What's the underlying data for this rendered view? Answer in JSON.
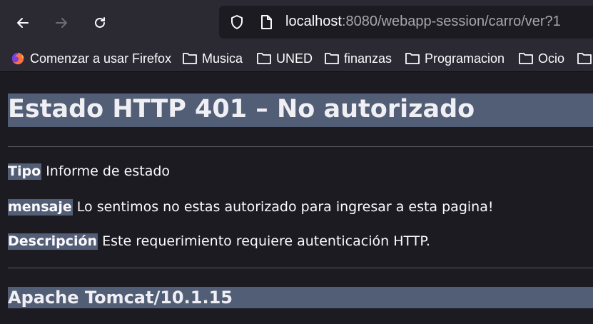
{
  "toolbar": {
    "back_icon": "arrow-left-icon",
    "forward_icon": "arrow-right-icon",
    "reload_icon": "reload-icon",
    "shield_icon": "shield-icon",
    "page_icon": "page-icon"
  },
  "urlbar": {
    "host": "localhost",
    "rest": ":8080/webapp-session/carro/ver?1"
  },
  "bookmarks": [
    {
      "label": "Comenzar a usar Firefox",
      "icon": "firefox-icon"
    },
    {
      "label": "Musica",
      "icon": "folder-icon"
    },
    {
      "label": "UNED",
      "icon": "folder-icon"
    },
    {
      "label": "finanzas",
      "icon": "folder-icon"
    },
    {
      "label": "Programacion",
      "icon": "folder-icon"
    },
    {
      "label": "Ocio",
      "icon": "folder-icon"
    }
  ],
  "page": {
    "title": "Estado HTTP 401 – No autorizado",
    "type_label": "Tipo",
    "type_value": "Informe de estado",
    "message_label": "mensaje",
    "message_value": "Lo sentimos no estas autorizado para ingresar a esta pagina!",
    "description_label": "Descripción",
    "description_value": "Este requerimiento requiere autenticación HTTP.",
    "footer": "Apache Tomcat/10.1.15"
  },
  "colors": {
    "toolbar_bg": "#2b2a33",
    "content_bg": "#1c1b22",
    "heading_bg": "#525d76",
    "text": "#fbfbfe",
    "url_muted": "#a6a6ad"
  }
}
